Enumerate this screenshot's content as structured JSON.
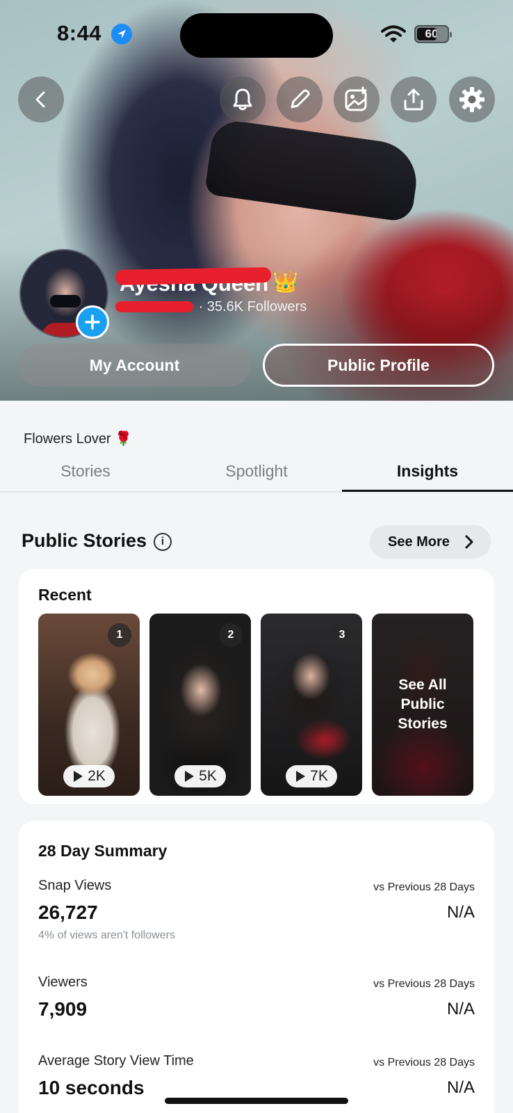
{
  "status_bar": {
    "time": "8:44",
    "battery": "60"
  },
  "profile": {
    "display_name": "Ayesha Queen",
    "name_emoji": "👑",
    "followers_separator": "·",
    "followers": "35.6K Followers",
    "bio": "Flowers Lover 🌹"
  },
  "header_buttons": {
    "my_account": "My Account",
    "public_profile": "Public Profile"
  },
  "tabs": [
    {
      "label": "Stories"
    },
    {
      "label": "Spotlight"
    },
    {
      "label": "Insights"
    }
  ],
  "public_stories": {
    "title": "Public Stories",
    "info": "i",
    "see_more": "See More",
    "recent_title": "Recent",
    "stories": [
      {
        "rank": "1",
        "views": "2K"
      },
      {
        "rank": "2",
        "views": "5K"
      },
      {
        "rank": "3",
        "views": "7K"
      }
    ],
    "see_all": "See All Public Stories"
  },
  "summary": {
    "title": "28 Day Summary",
    "stats": [
      {
        "label": "Snap Views",
        "value": "26,727",
        "note": "4% of views aren't followers",
        "vs_label": "vs Previous 28 Days",
        "vs_value": "N/A"
      },
      {
        "label": "Viewers",
        "value": "7,909",
        "vs_label": "vs Previous 28 Days",
        "vs_value": "N/A"
      },
      {
        "label": "Average Story View Time",
        "value": "10 seconds",
        "vs_label": "vs Previous 28 Days",
        "vs_value": "N/A"
      }
    ]
  }
}
